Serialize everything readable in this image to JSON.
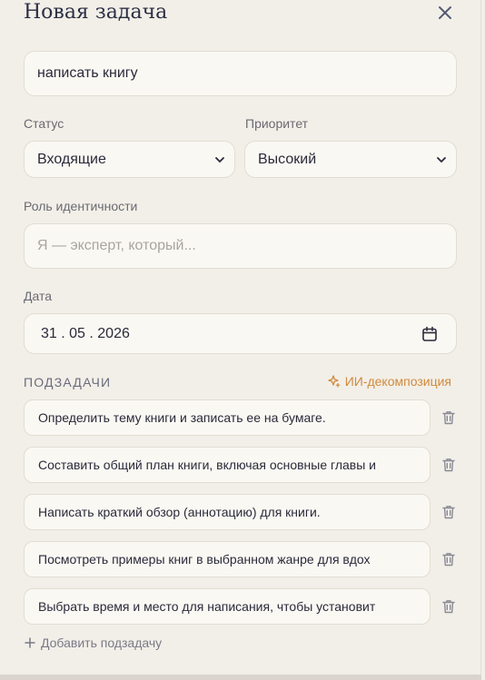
{
  "modal": {
    "title": "Новая задача",
    "close_icon": "close-icon"
  },
  "task": {
    "title_value": "написать книгу"
  },
  "status": {
    "label": "Статус",
    "value": "Входящие"
  },
  "priority": {
    "label": "Приоритет",
    "value": "Высокий"
  },
  "identity": {
    "label": "Роль идентичности",
    "placeholder": "Я — эксперт, который..."
  },
  "date": {
    "label": "Дата",
    "value": "31 . 05 . 2026"
  },
  "subtasks": {
    "title": "ПОДЗАДАЧИ",
    "ai_label": "ИИ-декомпозиция",
    "items": [
      "Определить тему книги и записать ее на бумаге.",
      "Составить общий план книги, включая основные главы и",
      "Написать краткий обзор (аннотацию) для книги.",
      "Посмотреть примеры книг в выбранном жанре для вдох",
      "Выбрать время и место для написания, чтобы установит"
    ],
    "add_label": "Добавить подзадачу"
  },
  "colors": {
    "accent": "#d08a3e",
    "title": "#2c2f45",
    "background": "#f2efe8"
  }
}
